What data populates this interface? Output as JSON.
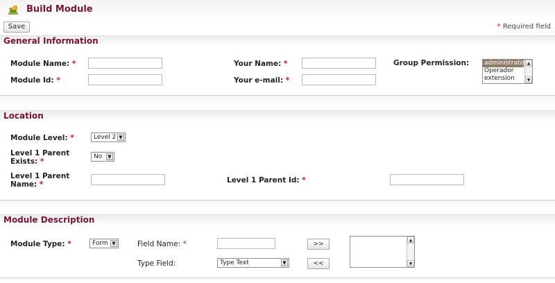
{
  "header": {
    "title": "Build Module",
    "icon": "module-build-icon"
  },
  "toolbar": {
    "save_label": "Save",
    "required_note": "Required field",
    "required_mark": "*"
  },
  "colors": {
    "section_title": "#7a1238",
    "required": "#d01010"
  },
  "general": {
    "title": "General Information",
    "module_name": "Module Name:",
    "module_id": "Module Id:",
    "your_name": "Your Name:",
    "your_email": "Your e-mail:",
    "group_permission": "Group Permission:",
    "permission_options": [
      "administrator",
      "Operador",
      "extension"
    ],
    "permission_selected": "administrator"
  },
  "location": {
    "title": "Location",
    "module_level": "Module Level:",
    "module_level_value": "Level 2",
    "parent_exists_line1": "Level 1 Parent",
    "parent_exists_line2": "Exists:",
    "parent_exists_value": "No",
    "parent_name_line1": "Level 1 Parent",
    "parent_name_line2": "Name:",
    "parent_id": "Level 1 Parent Id:"
  },
  "description": {
    "title": "Module Description",
    "module_type": "Module Type:",
    "module_type_value": "Form",
    "field_name": "Field Name:",
    "type_field": "Type Field:",
    "type_field_value": "Type Text",
    "add_label": ">>",
    "remove_label": "<<"
  }
}
